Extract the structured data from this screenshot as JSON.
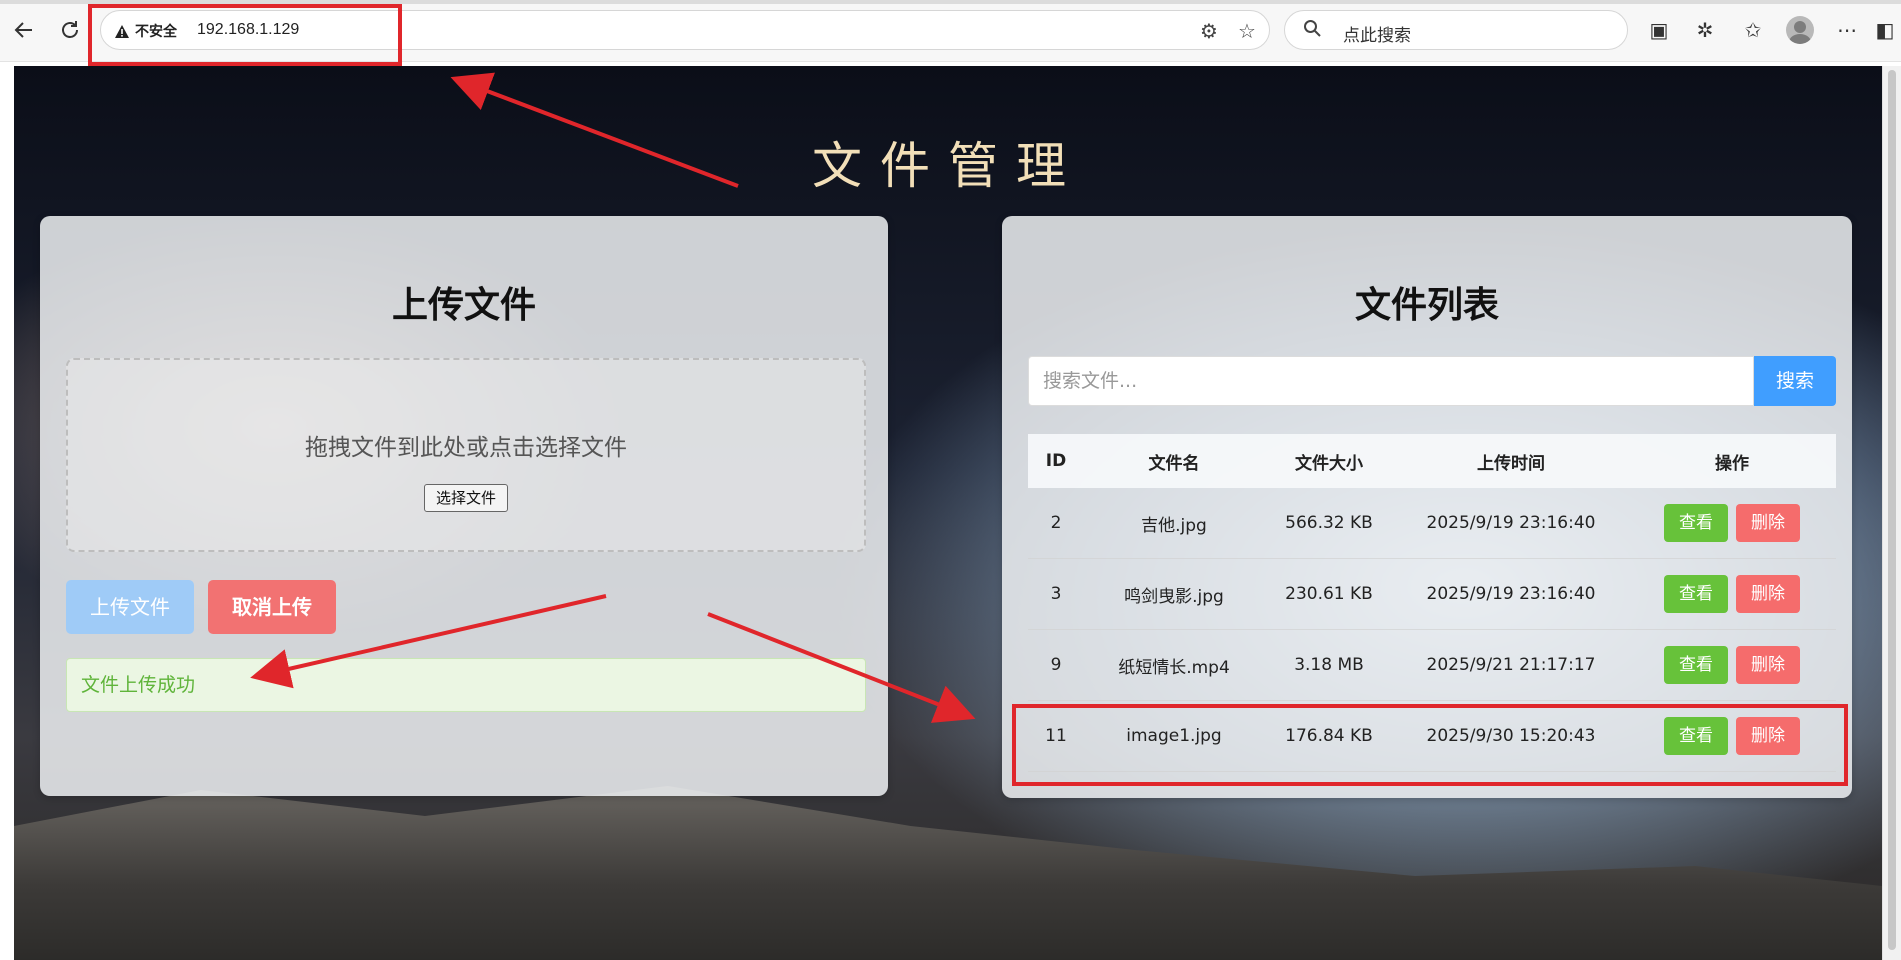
{
  "browser": {
    "security_label": "不安全",
    "url": "192.168.1.129",
    "search_placeholder": "点此搜索"
  },
  "page": {
    "title": "文件管理"
  },
  "upload": {
    "heading": "上传文件",
    "dropzone_text": "拖拽文件到此处或点击选择文件",
    "choose_label": "选择文件",
    "upload_button": "上传文件",
    "cancel_button": "取消上传",
    "status_message": "文件上传成功"
  },
  "file_list": {
    "heading": "文件列表",
    "search_placeholder": "搜索文件...",
    "search_button": "搜索",
    "columns": [
      "ID",
      "文件名",
      "文件大小",
      "上传时间",
      "操作"
    ],
    "view_label": "查看",
    "delete_label": "删除",
    "rows": [
      {
        "id": "2",
        "name": "吉他.jpg",
        "size": "566.32 KB",
        "time": "2025/9/19 23:16:40"
      },
      {
        "id": "3",
        "name": "鸣剑曳影.jpg",
        "size": "230.61 KB",
        "time": "2025/9/19 23:16:40"
      },
      {
        "id": "9",
        "name": "纸短情长.mp4",
        "size": "3.18 MB",
        "time": "2025/9/21 21:17:17"
      },
      {
        "id": "11",
        "name": "image1.jpg",
        "size": "176.84 KB",
        "time": "2025/9/30 15:20:43"
      }
    ]
  },
  "colors": {
    "primary": "#409eff",
    "success": "#67c23a",
    "danger": "#f56c6c",
    "annotation": "#e0262b",
    "title_gold": "#f2dfb8"
  }
}
